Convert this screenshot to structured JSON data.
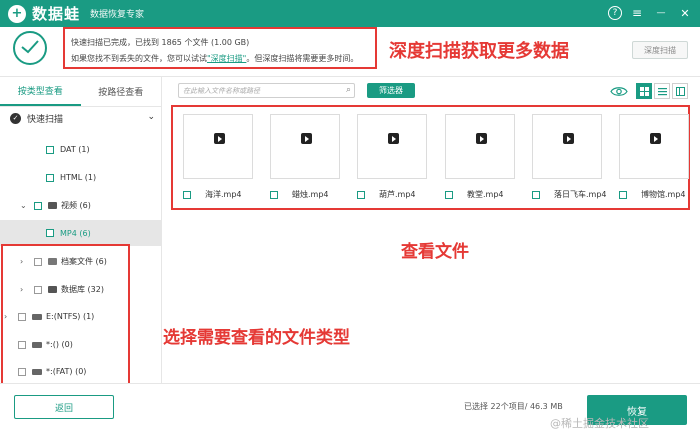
{
  "app": {
    "name": "数据蛙",
    "subtitle": "数据恢复专家",
    "logo_glyph": "+",
    "accent_color": "#1a9b83",
    "annotation_color": "#e53935"
  },
  "window_buttons": [
    {
      "icon": "help-icon",
      "glyph": "?"
    },
    {
      "icon": "menu-icon",
      "glyph": "≡"
    },
    {
      "icon": "minimize-icon",
      "glyph": "—"
    },
    {
      "icon": "close-icon",
      "glyph": "✕"
    }
  ],
  "info": {
    "line1": "快速扫描已完成，已找到 1865 个文件 (1.00 GB)",
    "line2_prefix": "如果您找不到丢失的文件，您可以试试",
    "line2_link": "\"深度扫描\"",
    "line2_suffix": "。但深度扫描将需要更多时间。",
    "deep_scan_button": "深度扫描"
  },
  "annotations": {
    "deep_scan": "深度扫描获取更多数据",
    "view_files": "查看文件",
    "choose_type": "选择需要查看的文件类型"
  },
  "left_panel": {
    "tabs": [
      {
        "label": "按类型查看",
        "active": true
      },
      {
        "label": "按路径查看",
        "active": false
      }
    ],
    "quick_scan_label": "快速扫描",
    "tree": [
      {
        "label": "DAT (1)"
      },
      {
        "label": "HTML (1)"
      },
      {
        "label": "视频 (6)"
      },
      {
        "label": "MP4 (6)",
        "selected": true
      },
      {
        "label": "档案文件 (6)"
      },
      {
        "label": "数据库 (32)"
      },
      {
        "label": "E:(NTFS) (1)"
      },
      {
        "label": "*:() (0)"
      },
      {
        "label": "*:(FAT) (0)"
      }
    ]
  },
  "toolbar": {
    "search_placeholder": "在此输入文件名称或路径",
    "filter_label": "筛选器"
  },
  "files": [
    {
      "name": "海洋.mp4"
    },
    {
      "name": "蜡烛.mp4"
    },
    {
      "name": "葫芦.mp4"
    },
    {
      "name": "教堂.mp4"
    },
    {
      "name": "落日飞车.mp4"
    },
    {
      "name": "博物馆.mp4"
    }
  ],
  "bottom": {
    "back_label": "返回",
    "status": "已选择 22个项目/ 46.3 MB",
    "recover_label": "恢复",
    "watermark": "@稀土掘金技术社区"
  }
}
